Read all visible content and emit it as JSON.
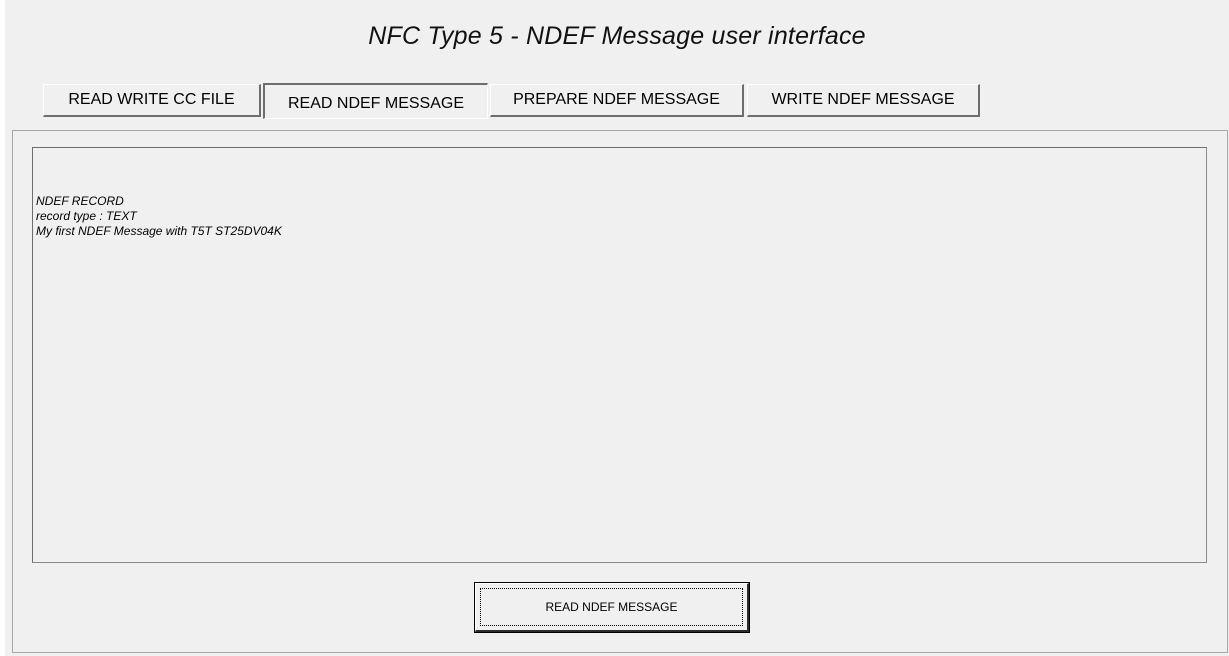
{
  "window": {
    "title": "NFC Type 5 - NDEF Message user interface"
  },
  "tabs": [
    {
      "label": "READ WRITE CC FILE",
      "active": false
    },
    {
      "label": "READ NDEF MESSAGE",
      "active": true
    },
    {
      "label": "PREPARE NDEF MESSAGE",
      "active": false
    },
    {
      "label": "WRITE NDEF MESSAGE",
      "active": false
    }
  ],
  "output": {
    "lines": [
      "NDEF RECORD",
      "record type : TEXT",
      "My first NDEF Message with T5T ST25DV04K"
    ]
  },
  "action": {
    "button_label": "READ NDEF MESSAGE"
  }
}
